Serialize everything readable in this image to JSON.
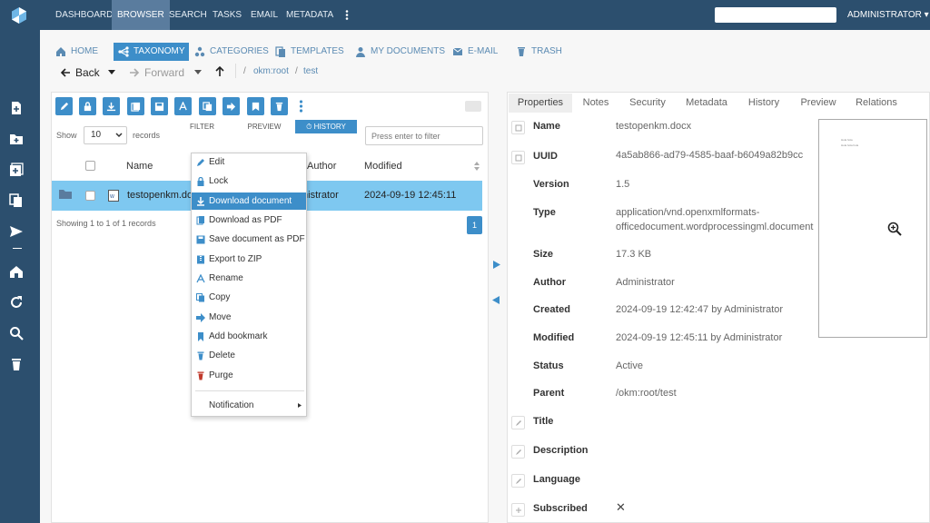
{
  "topbar": {
    "nav": [
      "DASHBOARD",
      "BROWSER",
      "SEARCH",
      "TASKS",
      "EMAIL",
      "METADATA"
    ],
    "active": "BROWSER",
    "search_value": "",
    "user_label": "ADMINISTRATOR"
  },
  "sidebar": {
    "icons": [
      "new-document-icon",
      "new-folder-icon",
      "add-icon",
      "copy-icon",
      "send-icon",
      "home-icon",
      "refresh-icon",
      "search-icon",
      "trash-icon"
    ]
  },
  "tabs": [
    "HOME",
    "TAXONOMY",
    "CATEGORIES",
    "TEMPLATES",
    "MY DOCUMENTS",
    "E-MAIL",
    "TRASH"
  ],
  "nav": {
    "back": "Back",
    "forward": "Forward",
    "crumbs": [
      "okm:root",
      "test"
    ]
  },
  "subtabs": [
    "FILTER",
    "PREVIEW",
    "HISTORY"
  ],
  "table": {
    "show_label": "Show",
    "page_size": "10",
    "records_label": "records",
    "filter_placeholder": "Press enter to filter",
    "headers": {
      "name": "Name",
      "author": "Author",
      "modified": "Modified"
    },
    "row": {
      "name": "testopenkm.docx",
      "author": "Administrator",
      "modified": "2024-09-19 12:45:11"
    },
    "info": "Showing 1 to 1 of 1 records",
    "page": "1"
  },
  "context_menu": {
    "items": [
      "Edit",
      "Lock",
      "Download document",
      "Download as PDF",
      "Save document as PDF",
      "Export to ZIP",
      "Rename",
      "Copy",
      "Move",
      "Add bookmark",
      "Delete",
      "Purge"
    ],
    "highlighted": "Download document",
    "notification": "Notification"
  },
  "properties": {
    "tabs": [
      "Properties",
      "Notes",
      "Security",
      "Metadata",
      "History",
      "Preview",
      "Relations"
    ],
    "active_tab": "Properties",
    "labels": {
      "name": "Name",
      "uuid": "UUID",
      "version": "Version",
      "type": "Type",
      "size": "Size",
      "author": "Author",
      "created": "Created",
      "modified": "Modified",
      "status": "Status",
      "parent": "Parent",
      "title": "Title",
      "description": "Description",
      "language": "Language",
      "subscribed": "Subscribed"
    },
    "values": {
      "name": "testopenkm.docx",
      "uuid": "4a5ab866-ad79-4585-baaf-b6049a82b9cc",
      "version": "1.5",
      "type_line1": "application/vnd.openxmlformats-",
      "type_line2": "officedocument.wordprocessingml.document",
      "size": "17.3 KB",
      "author": "Administrator",
      "created": "2024-09-19 12:42:47 by Administrator",
      "modified": "2024-09-19 12:45:11 by Administrator",
      "status": "Active",
      "parent": "/okm:root/test",
      "subscribed": "✕"
    }
  },
  "preview_text": [
    "Hola hola",
    "Hola hola hola"
  ],
  "colors": {
    "topbar": "#2c4f6e",
    "accent": "#3d8ec9",
    "selected_row": "#7ec8f0"
  }
}
